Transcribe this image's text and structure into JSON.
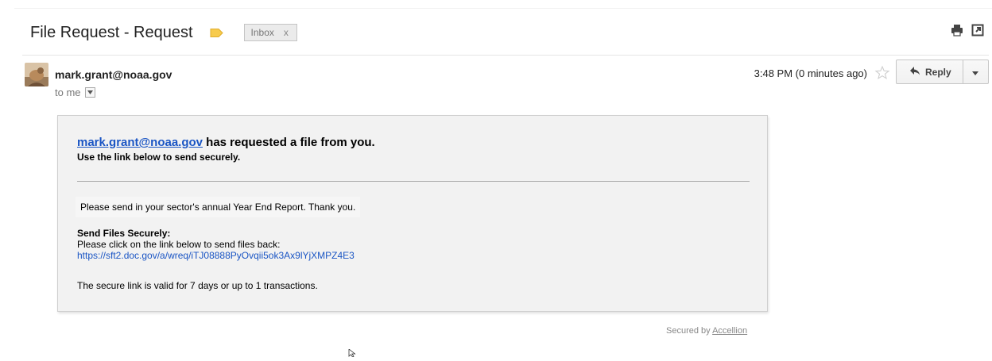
{
  "email": {
    "subject": "File Request - Request",
    "label_chip": "Inbox",
    "label_remove": "x",
    "sender": "mark.grant@noaa.gov",
    "recipient_line": "to me",
    "timestamp": "3:48 PM (0 minutes ago)",
    "reply_label": "Reply"
  },
  "message": {
    "requester_link": "mark.grant@noaa.gov",
    "headline_suffix": " has requested a file from you.",
    "subhead": "Use the link below to send securely.",
    "body_note": "Please send in your sector's annual Year End Report.  Thank you.",
    "send_title": "Send Files Securely:",
    "send_desc": "Please click on the link below to send files back:",
    "secure_link": "https://sft2.doc.gov/a/wreq/iTJ08888PyOvqii5ok3Ax9lYjXMPZ4E3",
    "validity": "The secure link is valid for 7 days or up to 1 transactions."
  },
  "footer": {
    "secured_prefix": "Secured by ",
    "secured_link": "Accellion"
  },
  "icons": {
    "importance": "importance-marker-icon",
    "print": "print-icon",
    "new_window": "new-window-icon",
    "star": "star-icon",
    "reply": "reply-arrow-icon",
    "menu": "chevron-down-icon",
    "details": "details-dropdown-icon"
  },
  "colors": {
    "importance_marker": "#f7cb4d",
    "link": "#1a55c4",
    "card_background": "#f2f2f2"
  }
}
